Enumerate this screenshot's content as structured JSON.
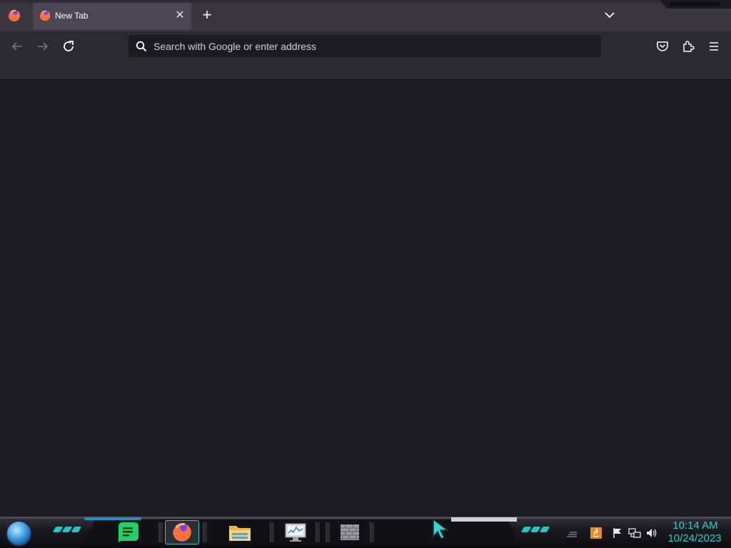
{
  "browser": {
    "tab": {
      "title": "New Tab"
    },
    "urlbar": {
      "placeholder": "Search with Google or enter address"
    }
  },
  "taskbar": {
    "pinned_apps": [
      "notes-app",
      "firefox",
      "file-explorer",
      "system-monitor",
      "firewall"
    ],
    "active_app": "firefox"
  },
  "clock": {
    "time": "10:14 AM",
    "date": "10/24/2023"
  },
  "colors": {
    "tabstrip": "#3a3740",
    "toolbar": "#2b2a33",
    "content": "#1c1b22",
    "accent_cyan": "#22d3d3"
  }
}
